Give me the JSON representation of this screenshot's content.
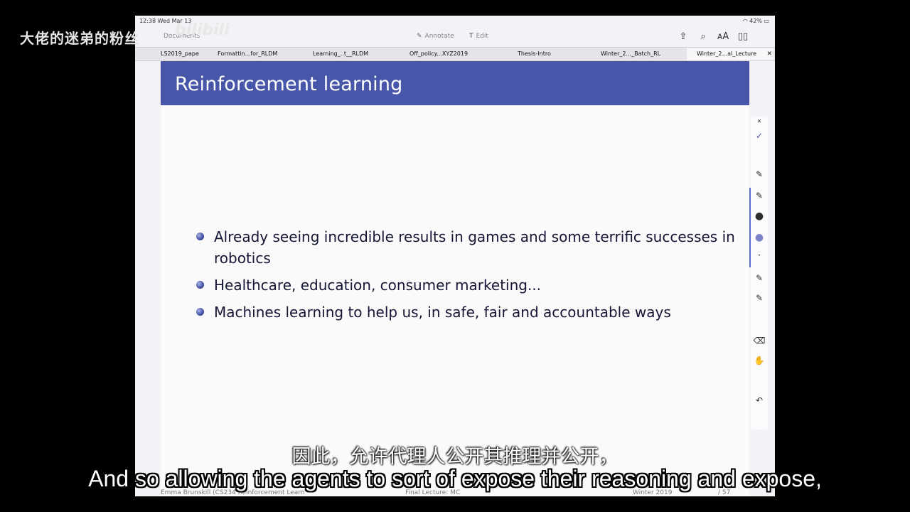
{
  "status": {
    "time": "12:38 Wed Mar 13",
    "battery": "42%"
  },
  "toolbar": {
    "documents_label": "Documents",
    "annotate_label": "Annotate",
    "edit_label": "Edit"
  },
  "tabs": [
    {
      "label": "LS2019_pape"
    },
    {
      "label": "Formattin...for_RLDM"
    },
    {
      "label": "Learning_..t__RLDM"
    },
    {
      "label": "Off_policy...XYZ2019"
    },
    {
      "label": "Thesis-Intro"
    },
    {
      "label": "Winter_2..._Batch_RL"
    },
    {
      "label": "Winter_2...al_Lecture"
    }
  ],
  "slide": {
    "title": "Reinforcement learning",
    "bullets": [
      "Already seeing incredible results in games and some terrific successes in robotics",
      "Healthcare, education, consumer marketing...",
      "Machines learning to help us, in safe, fair and accountable ways"
    ],
    "footer_author": "Emma Brunskill (CS234 Reinforcement Learn",
    "footer_title": "Final Lecture: MC",
    "footer_date": "Winter 2019",
    "footer_page": "/ 57"
  },
  "watermark": {
    "text": "大佬的迷弟的粉丝",
    "logo": "bilibili"
  },
  "subtitles": {
    "cn": "因此，允许代理人公开其推理并公开，",
    "en": "And so allowing the agents to sort of expose their reasoning and expose,"
  },
  "colors": {
    "header": "#4756a8",
    "accent": "#5a6acb"
  },
  "icons": [
    "wifi-icon",
    "battery-icon",
    "pencil-icon",
    "text-icon",
    "export-icon",
    "search-icon",
    "font-size-icon",
    "book-icon",
    "close-icon",
    "checkmark-icon",
    "pen-icon",
    "dot-icon",
    "eraser-icon",
    "hand-icon",
    "undo-icon"
  ]
}
